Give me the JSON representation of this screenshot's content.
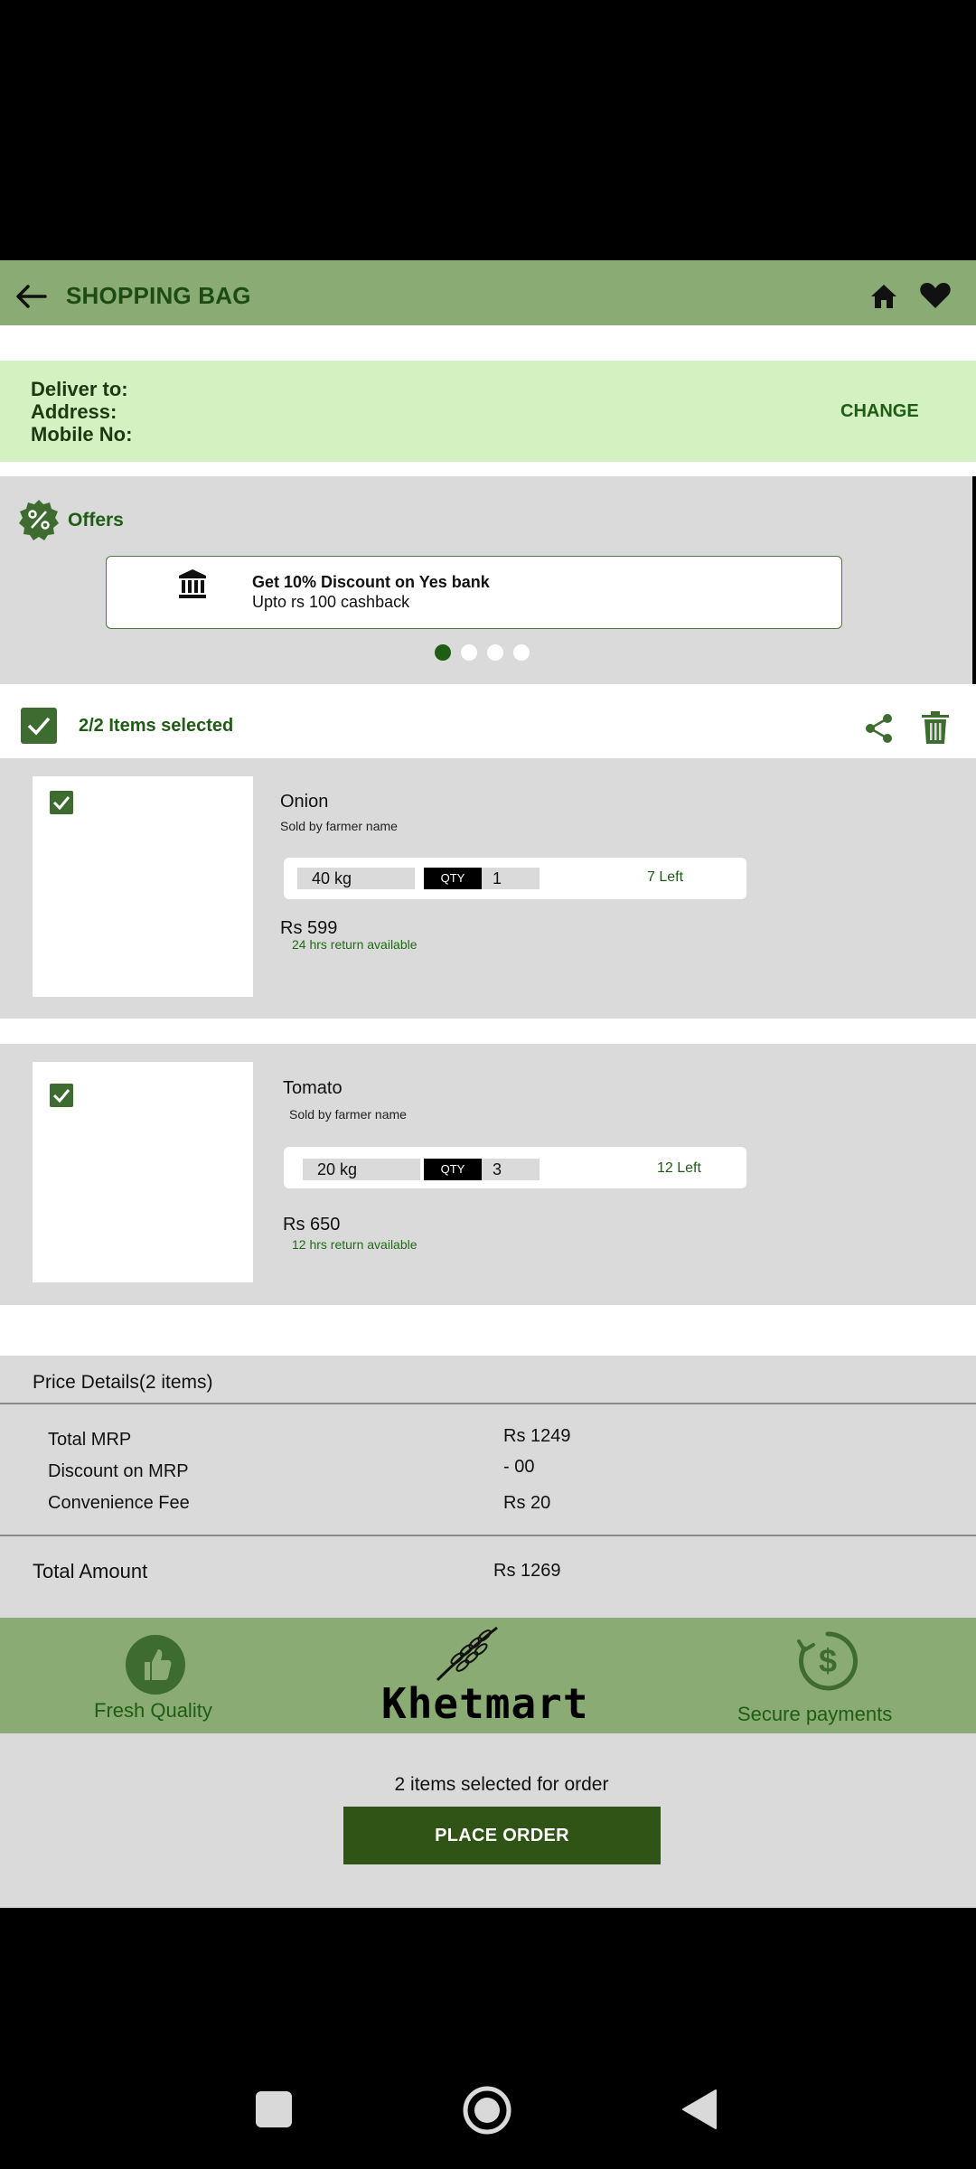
{
  "header": {
    "title": "SHOPPING BAG"
  },
  "delivery": {
    "deliver_to": "Deliver to:",
    "address": "Address:",
    "mobile": "Mobile No:",
    "change_label": "CHANGE"
  },
  "offers": {
    "label": "Offers",
    "card": {
      "title": "Get 10% Discount on Yes bank",
      "subtitle": "Upto rs 100 cashback"
    },
    "active_dot": 0
  },
  "selection": {
    "label": "2/2 Items selected"
  },
  "items": [
    {
      "name": "Onion",
      "seller": "Sold by farmer name",
      "weight": "40 kg",
      "qty_tag": "QTY",
      "qty": "1",
      "stock": "7 Left",
      "price": "Rs 599",
      "return_policy": "24 hrs return available"
    },
    {
      "name": "Tomato",
      "seller": "Sold by farmer name",
      "weight": "20 kg",
      "qty_tag": "QTY",
      "qty": "3",
      "stock": "12 Left",
      "price": "Rs 650",
      "return_policy": "12 hrs return available"
    }
  ],
  "price_details": {
    "title": "Price Details(2 items)",
    "rows": [
      {
        "label": "Total MRP",
        "value": "Rs 1249"
      },
      {
        "label": "Discount on MRP",
        "value": "- 00"
      },
      {
        "label": "Convenience Fee",
        "value": "Rs 20"
      }
    ],
    "total_label": "Total Amount",
    "total_value": "Rs 1269"
  },
  "features": {
    "quality": "Fresh Quality",
    "brand": "Khetmart",
    "payments": "Secure payments"
  },
  "order": {
    "count_text": "2 items selected for order",
    "button": "PLACE ORDER"
  },
  "colors": {
    "brand_green": "#8aab74",
    "dark_green": "#1f5c14",
    "light_green": "#d4f1c2",
    "button_green": "#2f5416",
    "panel_gray": "#dadada"
  }
}
